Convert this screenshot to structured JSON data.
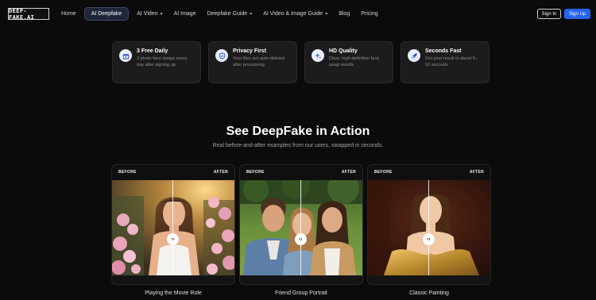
{
  "brand": {
    "logo": "DEEP-FAKE.AI"
  },
  "nav": {
    "items": [
      {
        "label": "Home",
        "dropdown": false
      },
      {
        "label": "AI Deepfake",
        "dropdown": false,
        "active": true
      },
      {
        "label": "AI Video",
        "dropdown": true
      },
      {
        "label": "AI Image",
        "dropdown": false
      },
      {
        "label": "Deepfake Guide",
        "dropdown": true
      },
      {
        "label": "AI Video & Image Guide",
        "dropdown": true
      },
      {
        "label": "Blog",
        "dropdown": false
      },
      {
        "label": "Pricing",
        "dropdown": false
      }
    ],
    "sign_in": "Sign In",
    "sign_up": "Sign Up"
  },
  "features": [
    {
      "title": "3 Free Daily",
      "desc": "3 photo face swaps every day after signing up",
      "icon": "gift-icon"
    },
    {
      "title": "Privacy First",
      "desc": "Your files are auto-deleted after processing",
      "icon": "shield-icon"
    },
    {
      "title": "HD Quality",
      "desc": "Clear, high-definition face swap results",
      "icon": "sparkle-icon"
    },
    {
      "title": "Seconds Fast",
      "desc": "Get your result in about 5–10 seconds",
      "icon": "rocket-icon"
    }
  ],
  "section": {
    "title": "See DeepFake in Action",
    "subtitle": "Real before-and-after examples from our users, swapped in seconds."
  },
  "compare_tags": {
    "before": "BEFORE",
    "after": "AFTER"
  },
  "examples": [
    {
      "label": "Playing the Movie Role"
    },
    {
      "label": "Friend Group Portrait"
    },
    {
      "label": "Classic Painting"
    }
  ],
  "colors": {
    "accent": "#2563eb",
    "background": "#0b0b0c",
    "card": "#1c1c1e"
  }
}
